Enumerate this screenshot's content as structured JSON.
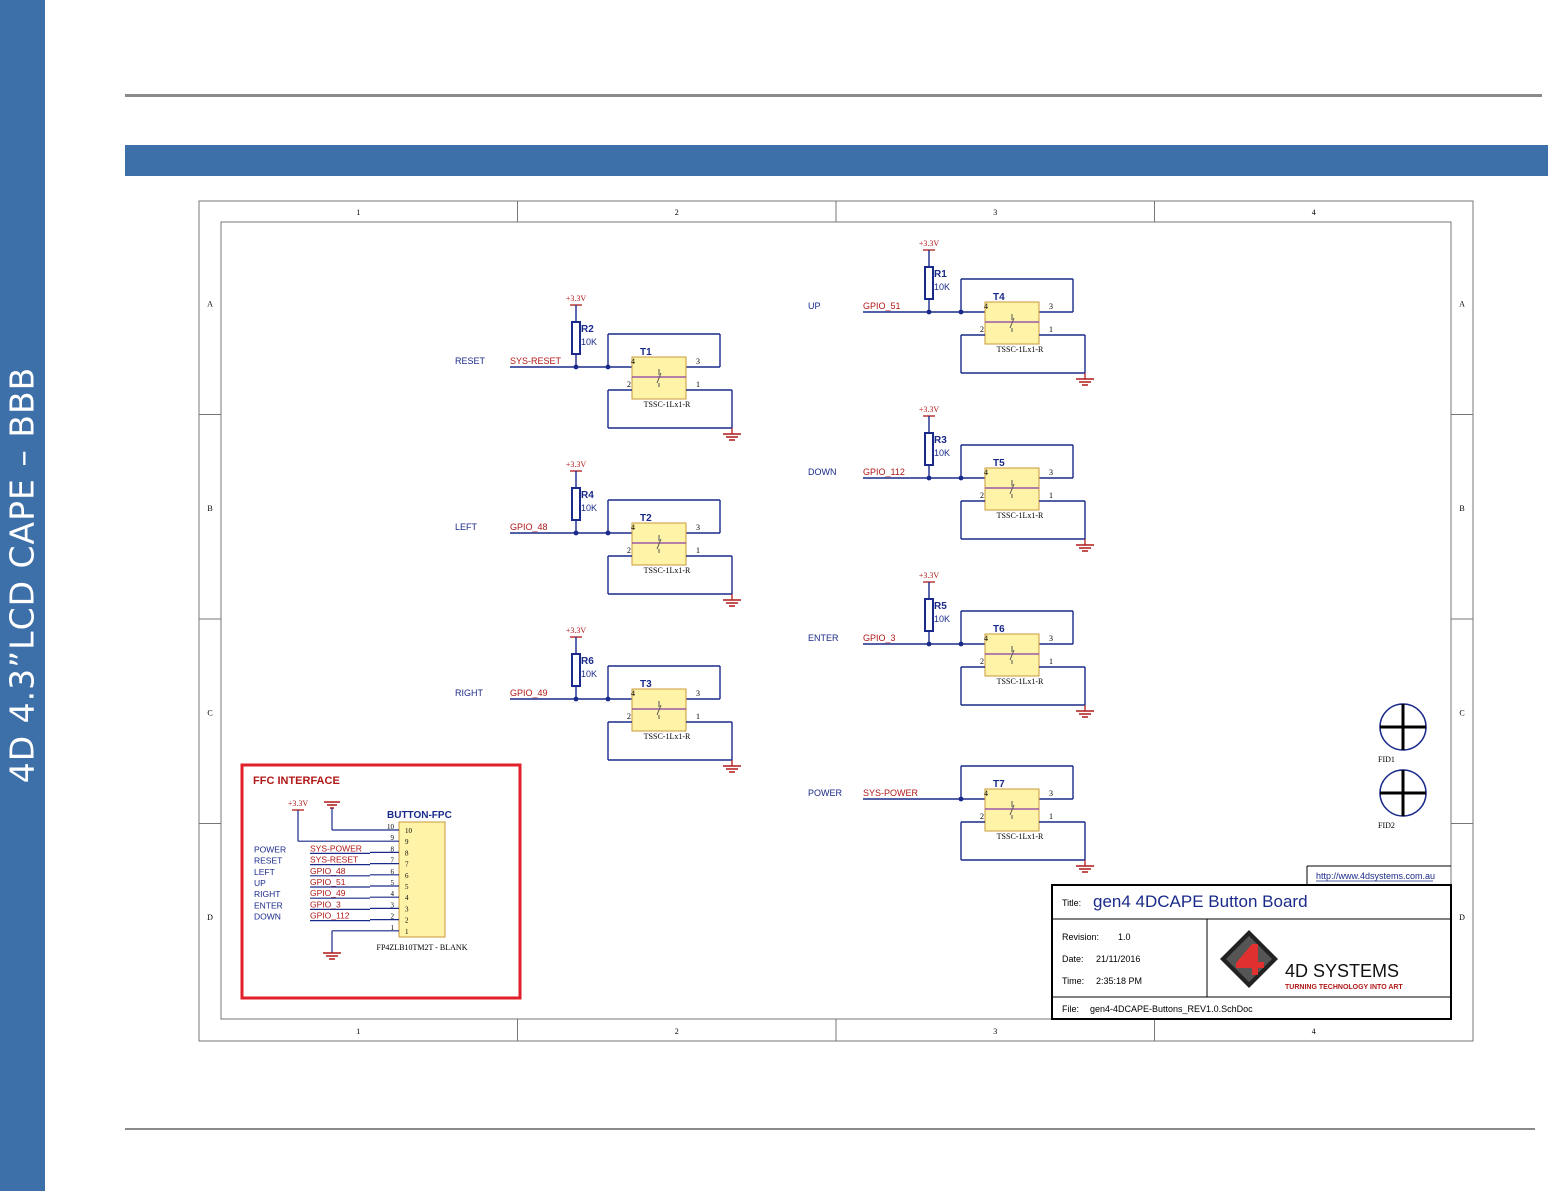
{
  "sidebar": {
    "title": "4D 4.3”LCD CAPE – BBB"
  },
  "frame": {
    "columns": [
      "1",
      "2",
      "3",
      "4"
    ],
    "rows": [
      "A",
      "B",
      "C",
      "D"
    ]
  },
  "supply_label": "+3.3V",
  "switch_part": "TSSC-1Lx1-R",
  "pins": {
    "p4": "4",
    "p3": "3",
    "p2": "2",
    "p1": "1"
  },
  "buttons": [
    {
      "ref": "T1",
      "label": "RESET",
      "net": "SYS-RESET",
      "resistor": "R2",
      "value": "10K"
    },
    {
      "ref": "T2",
      "label": "LEFT",
      "net": "GPIO_48",
      "resistor": "R4",
      "value": "10K"
    },
    {
      "ref": "T3",
      "label": "RIGHT",
      "net": "GPIO_49",
      "resistor": "R6",
      "value": "10K"
    },
    {
      "ref": "T4",
      "label": "UP",
      "net": "GPIO_51",
      "resistor": "R1",
      "value": "10K"
    },
    {
      "ref": "T5",
      "label": "DOWN",
      "net": "GPIO_112",
      "resistor": "R3",
      "value": "10K"
    },
    {
      "ref": "T6",
      "label": "ENTER",
      "net": "GPIO_3",
      "resistor": "R5",
      "value": "10K"
    },
    {
      "ref": "T7",
      "label": "POWER",
      "net": "SYS-POWER"
    }
  ],
  "ffc": {
    "title": "FFC INTERFACE",
    "connector_ref": "BUTTON-FPC",
    "part": "FP4ZLB10TM2T - BLANK",
    "supply": "+3.3V",
    "pins": [
      "10",
      "9",
      "8",
      "7",
      "6",
      "5",
      "4",
      "3",
      "2",
      "1"
    ],
    "signals": [
      {
        "label": "POWER",
        "net": "SYS-POWER"
      },
      {
        "label": "RESET",
        "net": "SYS-RESET"
      },
      {
        "label": "LEFT",
        "net": "GPIO_48"
      },
      {
        "label": "UP",
        "net": "GPIO_51"
      },
      {
        "label": "RIGHT",
        "net": "GPIO_49"
      },
      {
        "label": "ENTER",
        "net": "GPIO_3"
      },
      {
        "label": "DOWN",
        "net": "GPIO_112"
      }
    ]
  },
  "fiducials": [
    "FID1",
    "FID2"
  ],
  "title_block": {
    "url": "http://www.4dsystems.com.au",
    "title_label": "Title:",
    "title": "gen4 4DCAPE Button Board",
    "revision_label": "Revision:",
    "revision": "1.0",
    "date_label": "Date:",
    "date": "21/11/2016",
    "time_label": "Time:",
    "time": "2:35:18 PM",
    "file_label": "File:",
    "file": "gen4-4DCAPE-Buttons_REV1.0.SchDoc",
    "company": "4D SYSTEMS",
    "tagline": "TURNING TECHNOLOGY INTO ART"
  },
  "colors": {
    "brand_blue": "#3d6fa8",
    "wire": "#1a2a8a",
    "net_red": "#b01818",
    "ffc_border": "#e0202a",
    "switch_fill": "#fff3a8",
    "switch_stroke": "#c89a3a",
    "symbol_purple": "#8a3aa8"
  }
}
